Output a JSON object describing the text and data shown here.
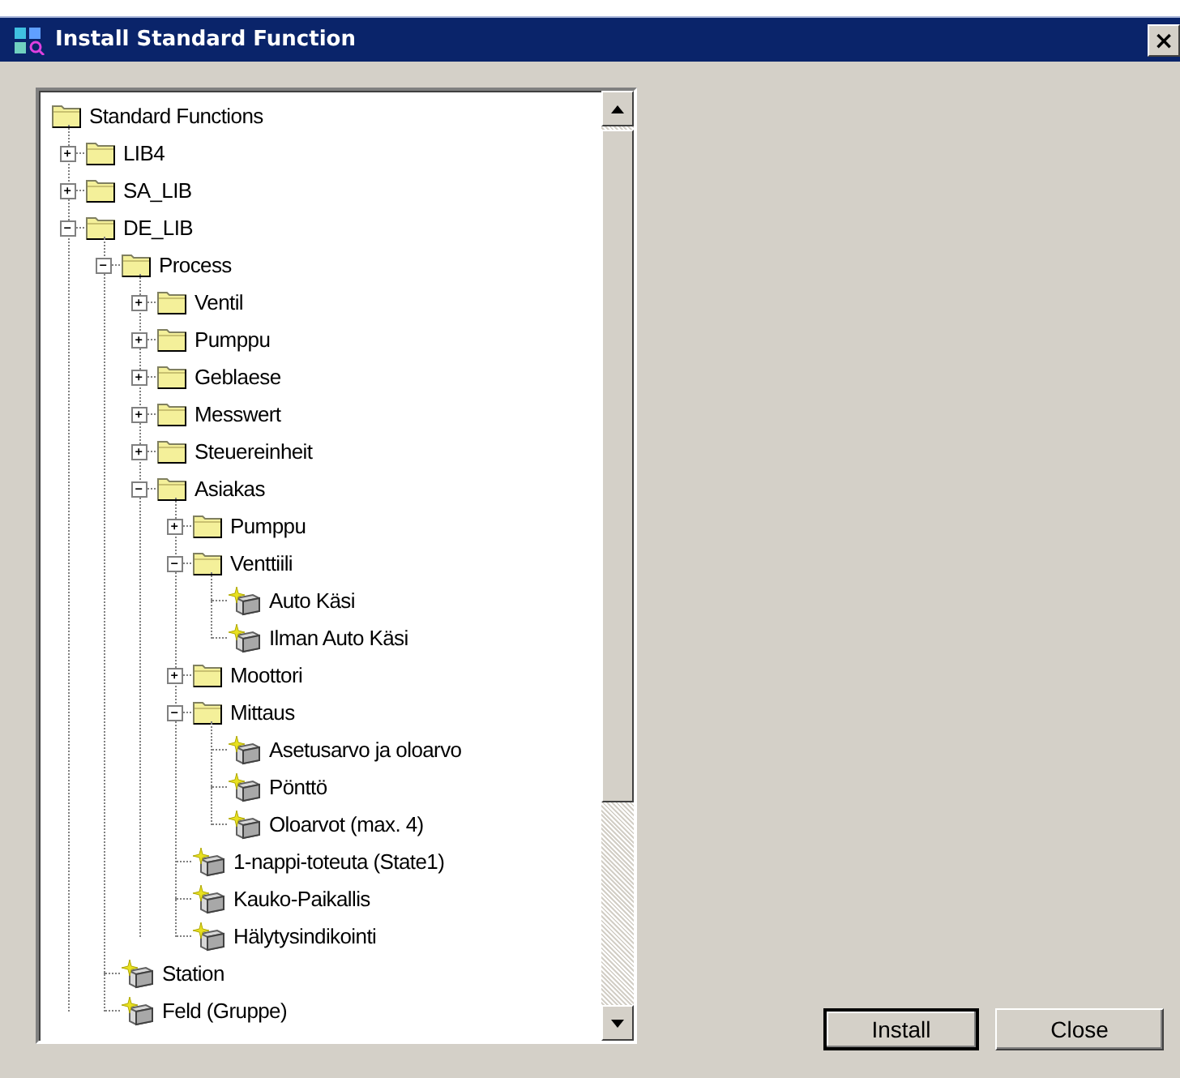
{
  "window": {
    "title": "Install Standard Function",
    "close_label": "×"
  },
  "tree": {
    "items": [
      {
        "label": "Standard Functions",
        "kind": "folder",
        "children": [
          {
            "label": "LIB4",
            "kind": "folder",
            "expanded": false
          },
          {
            "label": "SA_LIB",
            "kind": "folder",
            "expanded": false
          },
          {
            "label": "DE_LIB",
            "kind": "folder",
            "expanded": true,
            "children": [
              {
                "label": "Process",
                "kind": "folder",
                "expanded": true,
                "children": [
                  {
                    "label": "Ventil",
                    "kind": "folder",
                    "expanded": false
                  },
                  {
                    "label": "Pumppu",
                    "kind": "folder",
                    "expanded": false
                  },
                  {
                    "label": "Geblaese",
                    "kind": "folder",
                    "expanded": false
                  },
                  {
                    "label": "Messwert",
                    "kind": "folder",
                    "expanded": false
                  },
                  {
                    "label": "Steuereinheit",
                    "kind": "folder",
                    "expanded": false
                  },
                  {
                    "label": "Asiakas",
                    "kind": "folder",
                    "expanded": true,
                    "children": [
                      {
                        "label": "Pumppu",
                        "kind": "folder",
                        "expanded": false
                      },
                      {
                        "label": "Venttiili",
                        "kind": "folder",
                        "expanded": true,
                        "children": [
                          {
                            "label": "Auto Käsi",
                            "kind": "function"
                          },
                          {
                            "label": "Ilman Auto Käsi",
                            "kind": "function"
                          }
                        ]
                      },
                      {
                        "label": "Moottori",
                        "kind": "folder",
                        "expanded": false
                      },
                      {
                        "label": "Mittaus",
                        "kind": "folder",
                        "expanded": true,
                        "children": [
                          {
                            "label": "Asetusarvo ja oloarvo",
                            "kind": "function"
                          },
                          {
                            "label": "Pönttö",
                            "kind": "function"
                          },
                          {
                            "label": "Oloarvot (max. 4)",
                            "kind": "function"
                          }
                        ]
                      },
                      {
                        "label": "1-nappi-toteuta (State1)",
                        "kind": "function"
                      },
                      {
                        "label": "Kauko-Paikallis",
                        "kind": "function"
                      },
                      {
                        "label": "Hälytysindikointi",
                        "kind": "function"
                      }
                    ]
                  }
                ]
              },
              {
                "label": "Station",
                "kind": "function"
              },
              {
                "label": "Feld (Gruppe)",
                "kind": "function"
              }
            ]
          }
        ]
      }
    ]
  },
  "buttons": [
    {
      "label": "Install",
      "default": true
    },
    {
      "label": "Close",
      "default": false
    }
  ]
}
